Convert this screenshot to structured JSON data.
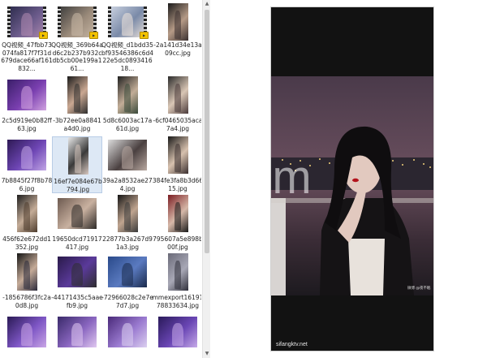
{
  "files": [
    {
      "name": "QQ视频_47fbb73074fa817f7f31d679dace66af161832...",
      "kind": "video"
    },
    {
      "name": "QQ视频_369b64ad6c2b237b932cdb5cb00e199a161...",
      "kind": "video"
    },
    {
      "name": "QQ视频_d1bdd35bf93546386c6d422e5dc089341618...",
      "kind": "video"
    },
    {
      "name": "-2a141d34e13a09cc.jpg",
      "kind": "image"
    },
    {
      "name": "2c5d919e0b82ff63.jpg",
      "kind": "image"
    },
    {
      "name": "-3b72ee0a8841a4d0.jpg",
      "kind": "image"
    },
    {
      "name": "5d8c6003ac17a61d.jpg",
      "kind": "image"
    },
    {
      "name": "-6cf0465035aca7a4.jpg",
      "kind": "image"
    },
    {
      "name": "7b8845f27f8b786.jpg",
      "kind": "image"
    },
    {
      "name": "16ef7e084e67b794.jpg",
      "kind": "image",
      "selected": true
    },
    {
      "name": "39a2a8532ae274.jpg",
      "kind": "image"
    },
    {
      "name": "384fe3fa8b3d6615.jpg",
      "kind": "image"
    },
    {
      "name": "456f62e672dd1352.jpg",
      "kind": "image"
    },
    {
      "name": "19650dcd71917417.jpg",
      "kind": "image"
    },
    {
      "name": "22877b3a267d91a3.jpg",
      "kind": "image"
    },
    {
      "name": "795607a5e898b00f.jpg",
      "kind": "image"
    },
    {
      "name": "-1856786f3fc2a0d8.jpg",
      "kind": "image"
    },
    {
      "name": "-44171435c5aaefb9.jpg",
      "kind": "image"
    },
    {
      "name": "-72966028c2e7e7d7.jpg",
      "kind": "image"
    },
    {
      "name": "mmexport1619178833634.jpg",
      "kind": "image"
    },
    {
      "name": "",
      "kind": "image"
    },
    {
      "name": "",
      "kind": "image"
    },
    {
      "name": "",
      "kind": "image"
    },
    {
      "name": "",
      "kind": "image"
    }
  ],
  "preview": {
    "watermark_site": "sifangktv.net",
    "big_watermark": ".com",
    "weibo_tag": "微博 @夜不眠"
  },
  "colors": {
    "preview_bg": "#121212",
    "selection": "#dde8f5",
    "video_badge": "#f2c200"
  }
}
